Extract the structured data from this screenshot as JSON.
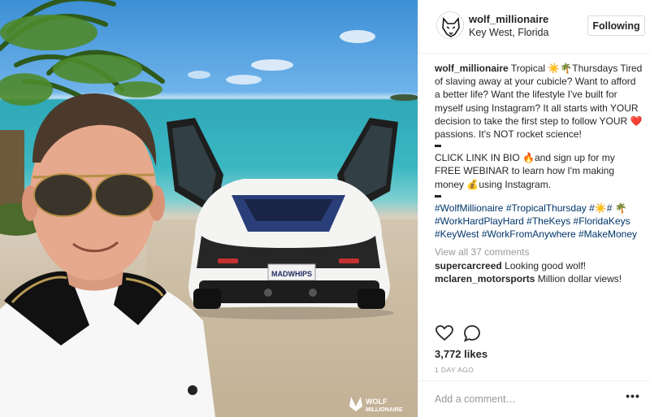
{
  "header": {
    "username": "wolf_millionaire",
    "location": "Key West, Florida",
    "follow_label": "Following"
  },
  "caption": {
    "username": "wolf_millionaire",
    "p1": {
      "a": "Tropical ",
      "e1": "☀️",
      "e2": "🌴",
      "b": "Thursdays Tired of slaving away at your cubicle? Want to afford a better life? Want the lifestyle I've built for myself using Instagram? It all starts with YOUR decision to take the first step to follow YOUR ",
      "e3": "❤️",
      "c": "passions. It's NOT rocket science!"
    },
    "p2": {
      "a": "CLICK LINK IN BIO ",
      "e1": "🔥",
      "b": "and sign up for my FREE WEBINAR to learn how I'm making money ",
      "e2": "💰",
      "c": "using Instagram."
    },
    "hashtags": {
      "h1": "#WolfMillionaire",
      "h2": "#TropicalThursday",
      "h3": "#",
      "e1": "☀️",
      "h4": "#",
      "e2": "🌴",
      "h5": "#WorkHardPlayHard",
      "h6": "#TheKeys",
      "h7": "#FloridaKeys",
      "h8": "#KeyWest",
      "h9": "#WorkFromAnywhere",
      "h10": "#MakeMoney"
    }
  },
  "view_all": "View all 37 comments",
  "comments": [
    {
      "user": "supercarcreed",
      "text": "Looking good wolf!"
    },
    {
      "user": "mclaren_motorsports",
      "text": "Million dollar views!"
    }
  ],
  "likes": "3,772 likes",
  "time": "1 DAY AGO",
  "add_comment_placeholder": "Add a comment…",
  "more_options": "•••",
  "photo": {
    "license_plate": "MADWHIPS",
    "watermark_line1": "WOLF",
    "watermark_line2": "MILLIONAIRE"
  },
  "icons": {
    "like": "heart-icon",
    "comment": "comment-icon",
    "avatar": "wolf-logo-icon",
    "more": "more-options-icon"
  },
  "colors": {
    "text": "#262626",
    "muted": "#999999",
    "hashtag": "#003569",
    "border": "#efefef"
  }
}
